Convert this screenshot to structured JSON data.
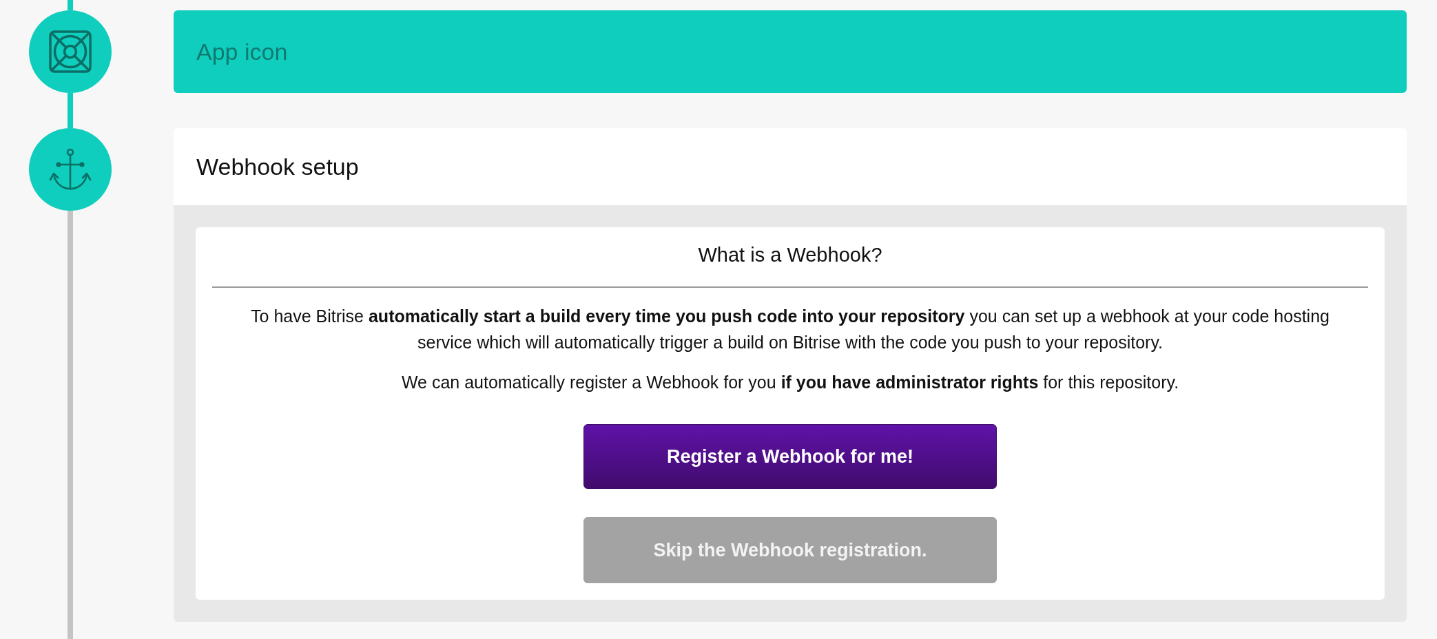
{
  "steps": [
    {
      "title": "App icon",
      "completed": true
    },
    {
      "title": "Webhook setup",
      "completed": false,
      "content": {
        "heading": "What is a Webhook?",
        "paragraphs": [
          "To have Bitrise **automatically start a build every time you push code into your repository** you can set up a webhook at your code hosting service which will automatically trigger a build on Bitrise with the code you push to your repository.",
          "We can automatically register a Webhook for you **if you have administrator rights** for this repository."
        ],
        "buttons": [
          {
            "label": "Register a Webhook for me!",
            "kind": "primary"
          },
          {
            "label": "Skip the Webhook registration.",
            "kind": "secondary"
          }
        ]
      }
    }
  ]
}
